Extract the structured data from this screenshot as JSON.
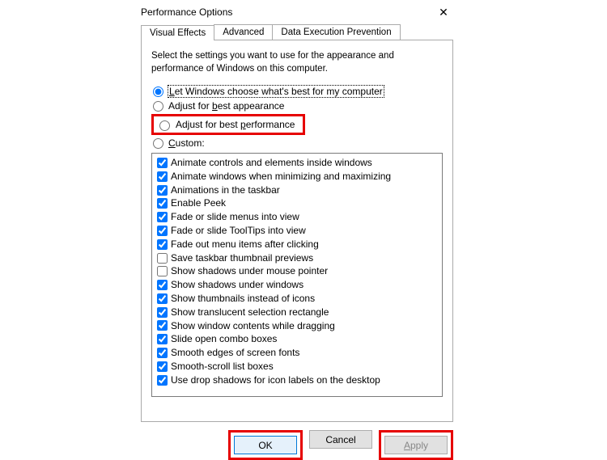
{
  "window": {
    "title": "Performance Options",
    "close_glyph": "✕"
  },
  "tabs": {
    "items": [
      {
        "label": "Visual Effects",
        "active": true
      },
      {
        "label": "Advanced",
        "active": false
      },
      {
        "label": "Data Execution Prevention",
        "active": false
      }
    ]
  },
  "instruction": "Select the settings you want to use for the appearance and performance of Windows on this computer.",
  "radios": {
    "let_windows": {
      "pre": "L",
      "mid": "et Windows choose what's best for my computer",
      "checked": true
    },
    "best_appearance": {
      "pre": "Adjust for ",
      "u": "b",
      "post": "est appearance",
      "checked": false
    },
    "best_performance": {
      "pre": "Adjust for best ",
      "u": "p",
      "post": "erformance",
      "checked": false
    },
    "custom": {
      "u": "C",
      "post": "ustom:",
      "checked": false
    }
  },
  "checks": [
    {
      "label": "Animate controls and elements inside windows",
      "checked": true
    },
    {
      "label": "Animate windows when minimizing and maximizing",
      "checked": true
    },
    {
      "label": "Animations in the taskbar",
      "checked": true
    },
    {
      "label": "Enable Peek",
      "checked": true
    },
    {
      "label": "Fade or slide menus into view",
      "checked": true
    },
    {
      "label": "Fade or slide ToolTips into view",
      "checked": true
    },
    {
      "label": "Fade out menu items after clicking",
      "checked": true
    },
    {
      "label": "Save taskbar thumbnail previews",
      "checked": false
    },
    {
      "label": "Show shadows under mouse pointer",
      "checked": false
    },
    {
      "label": "Show shadows under windows",
      "checked": true
    },
    {
      "label": "Show thumbnails instead of icons",
      "checked": true
    },
    {
      "label": "Show translucent selection rectangle",
      "checked": true
    },
    {
      "label": "Show window contents while dragging",
      "checked": true
    },
    {
      "label": "Slide open combo boxes",
      "checked": true
    },
    {
      "label": "Smooth edges of screen fonts",
      "checked": true
    },
    {
      "label": "Smooth-scroll list boxes",
      "checked": true
    },
    {
      "label": "Use drop shadows for icon labels on the desktop",
      "checked": true
    }
  ],
  "buttons": {
    "ok": "OK",
    "cancel": "Cancel",
    "apply": {
      "pre": "A",
      "post": "pply"
    }
  }
}
